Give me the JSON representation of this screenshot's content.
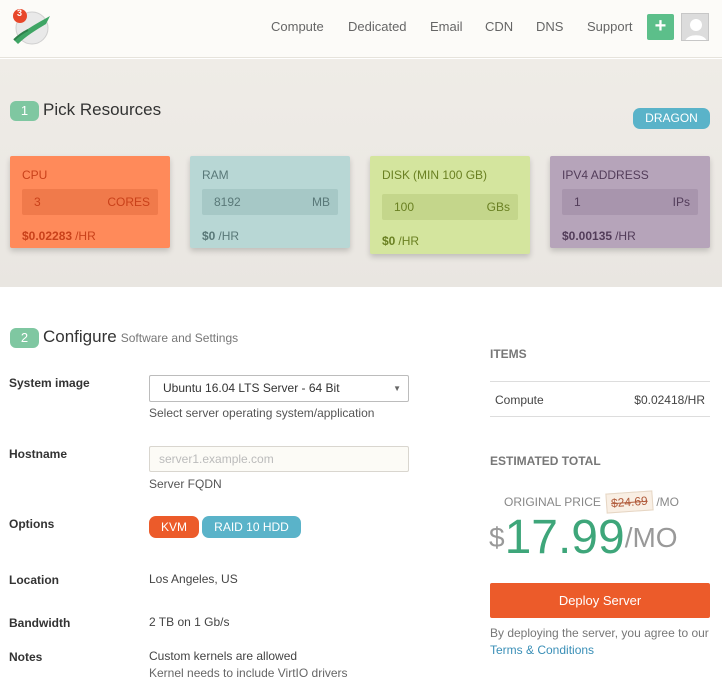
{
  "logo": {
    "badge": "3"
  },
  "nav": {
    "items": [
      "Compute",
      "Dedicated",
      "Email",
      "CDN",
      "DNS",
      "Support"
    ],
    "plus_label": "+"
  },
  "resources": {
    "step": "1",
    "title": "Pick Resources",
    "plan_tag": "DRAGON",
    "cards": [
      {
        "label": "CPU",
        "label_suffix": "",
        "value": "3",
        "unit": "CORES",
        "price": "$0.02283",
        "per": "/HR",
        "bg": "#ff8a5a",
        "input_bg": "#f07a4b",
        "text_color": "#c9411a"
      },
      {
        "label": "RAM",
        "label_suffix": "",
        "value": "8192",
        "unit": "MB",
        "price": "$0",
        "per": "/HR",
        "bg": "#b8d7d5",
        "input_bg": "#a6c8c6",
        "text_color": "#597878"
      },
      {
        "label": "DISK",
        "label_suffix": "(MIN 100 GB)",
        "value": "100",
        "unit": "GBs",
        "price": "$0",
        "per": "/HR",
        "bg": "#d4e59e",
        "input_bg": "#c4d68b",
        "text_color": "#6a8022"
      },
      {
        "label": "IPV4 ADDRESS",
        "label_suffix": "",
        "value": "1",
        "unit": "IPs",
        "price": "$0.00135",
        "per": "/HR",
        "bg": "#b6a4ba",
        "input_bg": "#a895ad",
        "text_color": "#523c59"
      }
    ]
  },
  "configure": {
    "step": "2",
    "title": "Configure",
    "subtitle": "Software and Settings",
    "system_image": {
      "label": "System image",
      "value": "Ubuntu 16.04 LTS Server - 64 Bit",
      "helper": "Select server operating system/application"
    },
    "hostname": {
      "label": "Hostname",
      "placeholder": "server1.example.com",
      "helper": "Server FQDN"
    },
    "options": {
      "label": "Options",
      "tags": [
        "KVM",
        "RAID 10 HDD"
      ]
    },
    "location": {
      "label": "Location",
      "value": "Los Angeles, US"
    },
    "bandwidth": {
      "label": "Bandwidth",
      "value": "2 TB on 1 Gb/s"
    },
    "notes": {
      "label": "Notes",
      "lines": [
        "Custom kernels are allowed",
        "Kernel needs to include VirtIO drivers"
      ]
    }
  },
  "summary": {
    "items_title": "ITEMS",
    "items": [
      {
        "name": "Compute",
        "price": "$0.02418/HR"
      }
    ],
    "estimated_title": "ESTIMATED TOTAL",
    "original_label": "ORIGINAL PRICE",
    "original_price": "$24.69",
    "original_per": "/MO",
    "currency": "$",
    "price": "17.99",
    "per": "/MO",
    "deploy_label": "Deploy Server",
    "agree_text": "By deploying the server, you agree to our ",
    "terms_link": "Terms & Conditions"
  },
  "colors": {
    "accent": "#ec5b2a",
    "green": "#3ea67a",
    "teal": "#5ab3c9"
  }
}
